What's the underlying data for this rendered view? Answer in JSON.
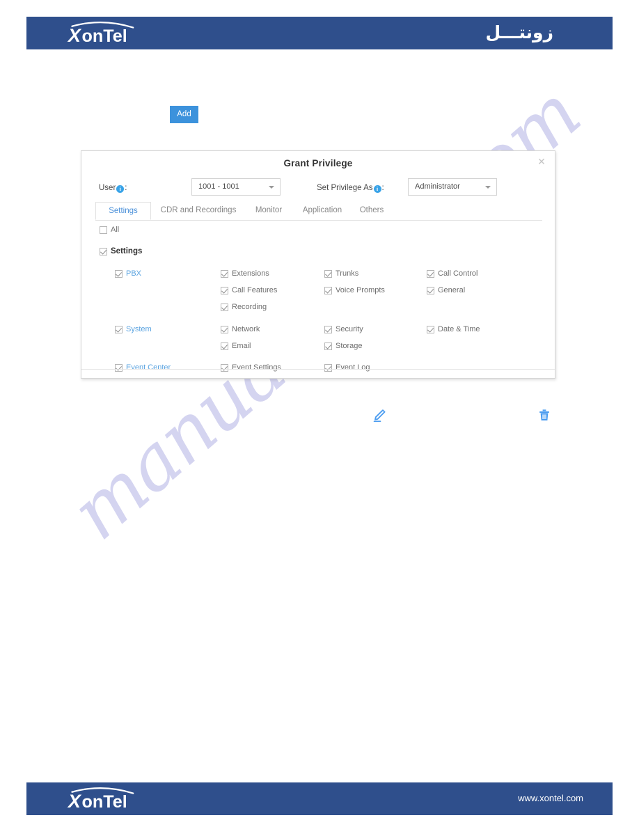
{
  "header": {
    "logo_text": "XonTel",
    "logo_icon": "xontel-logo",
    "arabic_brand": "زونتـــل",
    "bar_color": "#2f4f8c"
  },
  "toolbar": {
    "add_label": "Add"
  },
  "dialog": {
    "title": "Grant Privilege",
    "close_icon": "close-icon",
    "fields": {
      "user": {
        "label": "User",
        "suffix": ":",
        "info_icon": "info-icon",
        "value": "1001 - 1001"
      },
      "privilege": {
        "label": "Set Privilege As",
        "suffix": ":",
        "info_icon": "info-icon",
        "value": "Administrator"
      }
    },
    "tabs": [
      {
        "label": "Settings",
        "active": true
      },
      {
        "label": "CDR and Recordings",
        "active": false
      },
      {
        "label": "Monitor",
        "active": false
      },
      {
        "label": "Application",
        "active": false
      },
      {
        "label": "Others",
        "active": false
      }
    ],
    "all_checkbox": {
      "label": "All",
      "checked": false
    },
    "tree": {
      "root": {
        "label": "Settings",
        "checked": true
      },
      "categories": [
        {
          "label": "PBX",
          "checked": true,
          "rows": [
            [
              {
                "label": "Extensions",
                "checked": true
              },
              {
                "label": "Trunks",
                "checked": true
              },
              {
                "label": "Call Control",
                "checked": true
              }
            ],
            [
              {
                "label": "Call Features",
                "checked": true
              },
              {
                "label": "Voice Prompts",
                "checked": true
              },
              {
                "label": "General",
                "checked": true
              }
            ],
            [
              {
                "label": "Recording",
                "checked": true
              }
            ]
          ]
        },
        {
          "label": "System",
          "checked": true,
          "rows": [
            [
              {
                "label": "Network",
                "checked": true
              },
              {
                "label": "Security",
                "checked": true
              },
              {
                "label": "Date & Time",
                "checked": true
              }
            ],
            [
              {
                "label": "Email",
                "checked": true
              },
              {
                "label": "Storage",
                "checked": true
              }
            ]
          ]
        },
        {
          "label": "Event Center",
          "checked": true,
          "rows": [
            [
              {
                "label": "Event Settings",
                "checked": true
              },
              {
                "label": "Event Log",
                "checked": true
              }
            ]
          ]
        }
      ]
    }
  },
  "actions": {
    "edit_icon": "edit-pencil-icon",
    "delete_icon": "trash-icon",
    "accent_color": "#4a9cf0"
  },
  "watermark": {
    "text": "manualshive.com",
    "color": "#c9c9ec"
  },
  "footer": {
    "logo_text": "XonTel",
    "logo_icon": "xontel-logo",
    "url": "www.xontel.com",
    "bar_color": "#2f4f8c"
  }
}
